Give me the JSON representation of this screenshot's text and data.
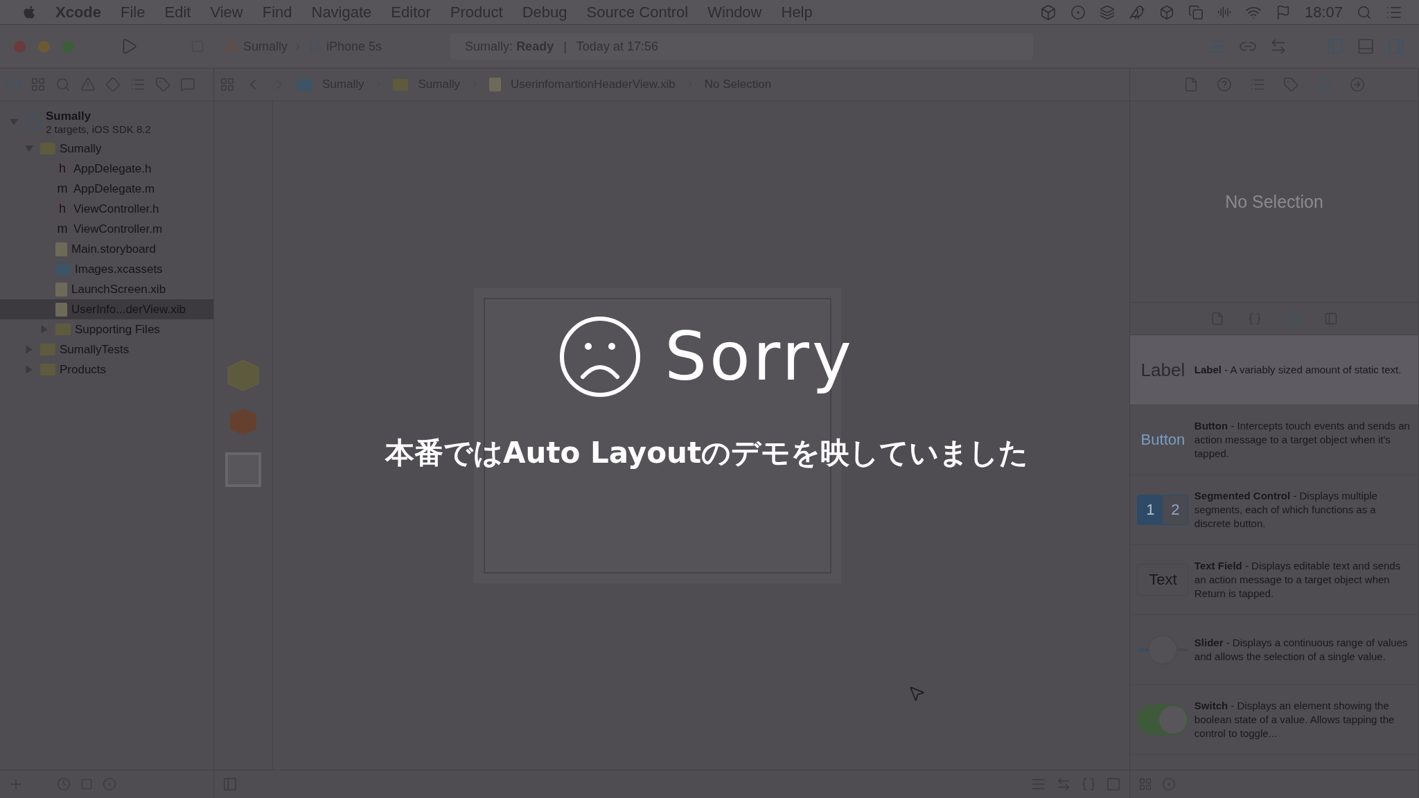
{
  "menu_bar": {
    "app": "Xcode",
    "items": [
      "File",
      "Edit",
      "View",
      "Find",
      "Navigate",
      "Editor",
      "Product",
      "Debug",
      "Source Control",
      "Window",
      "Help"
    ],
    "clock": "18:07"
  },
  "toolbar": {
    "scheme": "Sumally",
    "device": "iPhone 5s",
    "status": "Sumally: **Ready**",
    "separator": "|",
    "time": "Today at 17:56"
  },
  "jump_bar": [
    "Sumally",
    "Sumally",
    "UserinfomartionHeaderView.xib",
    "No Selection"
  ],
  "navigator": {
    "project": {
      "name": "Sumally",
      "subtitle": "2 targets, iOS SDK 8.2",
      "expanded": true,
      "children": [
        {
          "name": "Sumally",
          "kind": "folder",
          "expanded": true,
          "selected": false,
          "children": [
            {
              "name": "AppDelegate.h",
              "kind": "header",
              "badge": "h",
              "selected": false
            },
            {
              "name": "AppDelegate.m",
              "kind": "source",
              "badge": "m",
              "selected": false
            },
            {
              "name": "ViewController.h",
              "kind": "header",
              "badge": "h",
              "selected": false
            },
            {
              "name": "ViewController.m",
              "kind": "source",
              "badge": "m",
              "selected": false
            },
            {
              "name": "Main.storyboard",
              "kind": "storyboard",
              "selected": false
            },
            {
              "name": "Images.xcassets",
              "kind": "assets",
              "selected": false
            },
            {
              "name": "LaunchScreen.xib",
              "kind": "xib",
              "selected": false
            },
            {
              "name": "UserInfo...derView.xib",
              "kind": "xib",
              "selected": true
            },
            {
              "name": "Supporting Files",
              "kind": "folder",
              "expanded": false,
              "selected": false
            }
          ]
        },
        {
          "name": "SumallyTests",
          "kind": "folder",
          "expanded": false,
          "selected": false
        },
        {
          "name": "Products",
          "kind": "folder",
          "expanded": false,
          "selected": false
        }
      ]
    }
  },
  "inspector": {
    "empty_text": "No Selection"
  },
  "library": [
    {
      "kind": "label",
      "preview": "Label",
      "title": "Label",
      "description": " - A variably sized amount of static text.",
      "selected": true
    },
    {
      "kind": "button",
      "preview": "Button",
      "title": "Button",
      "description": " - Intercepts touch events and sends an action message to a target object when it's tapped.",
      "selected": false
    },
    {
      "kind": "segmented",
      "segments": [
        "1",
        "2"
      ],
      "title": "Segmented Control",
      "description": " - Displays multiple segments, each of which functions as a discrete button.",
      "selected": false
    },
    {
      "kind": "textfield",
      "preview": "Text",
      "title": "Text Field",
      "description": " - Displays editable text and sends an action message to a target object when Return is tapped.",
      "selected": false
    },
    {
      "kind": "slider",
      "level": 0.15,
      "title": "Slider",
      "description": " - Displays a continuous range of values and allows the selection of a single value.",
      "selected": false
    },
    {
      "kind": "switch",
      "on": true,
      "title": "Switch",
      "description": " - Displays an element showing the boolean state of a value. Allows tapping the control to toggle...",
      "selected": false
    }
  ],
  "overlay": {
    "title": "Sorry",
    "message": "本番ではAuto Layoutのデモを映していました"
  }
}
